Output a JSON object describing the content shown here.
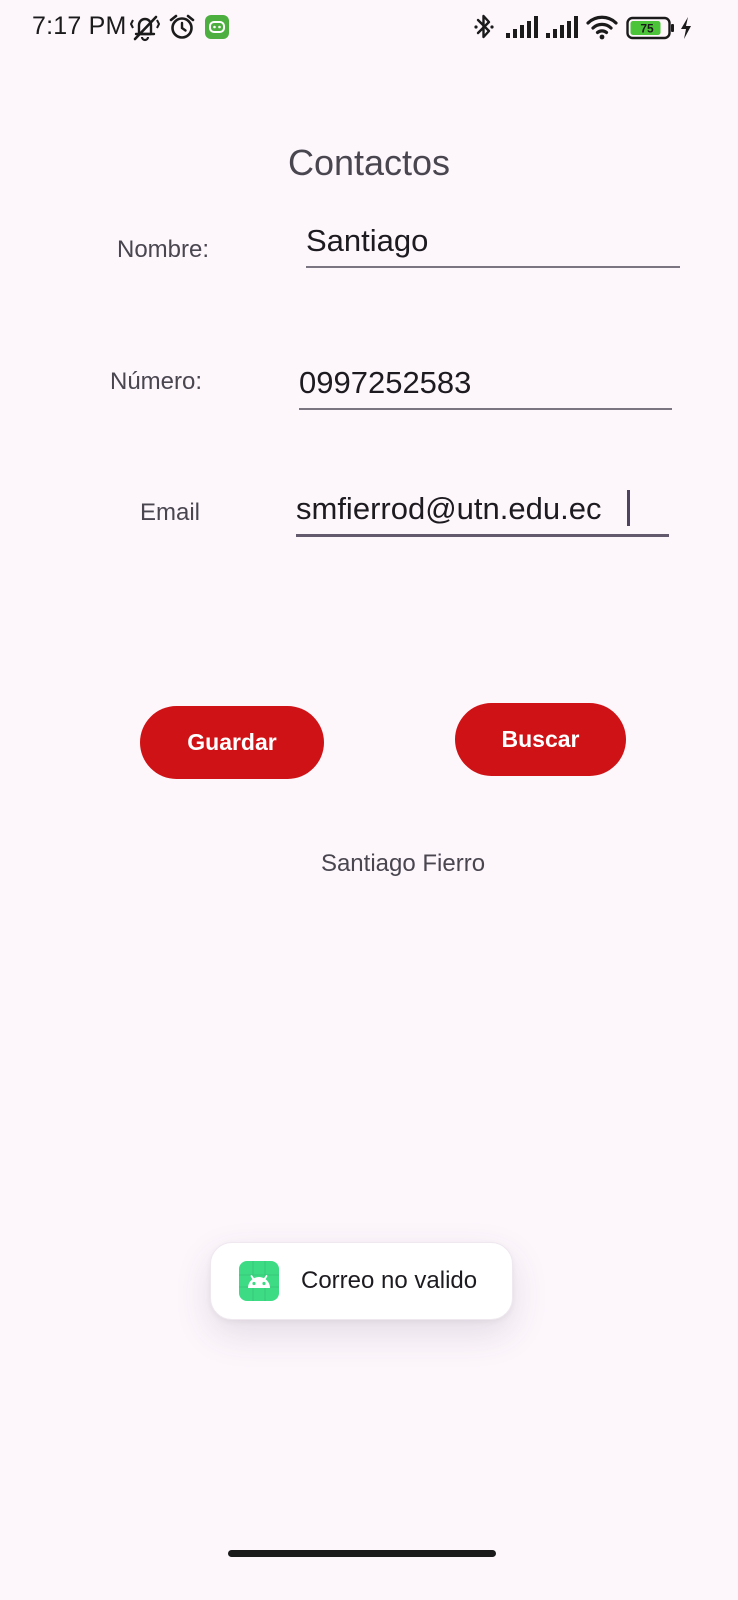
{
  "status_bar": {
    "time": "7:17 PM",
    "battery_level": "75",
    "icons": [
      "vibrate-off-icon",
      "alarm-icon",
      "app-notification-icon",
      "bluetooth-icon",
      "signal-icon",
      "signal-icon",
      "wifi-icon",
      "battery-icon",
      "charging-icon"
    ]
  },
  "page": {
    "title": "Contactos"
  },
  "form": {
    "name_label": "Nombre:",
    "name_value": "Santiago",
    "number_label": "Número:",
    "number_value": "0997252583",
    "email_label": "Email",
    "email_value": "smfierrod@utn.edu.ec"
  },
  "actions": {
    "save_label": "Guardar",
    "search_label": "Buscar"
  },
  "result": {
    "text": "Santiago Fierro"
  },
  "toast": {
    "icon": "android-icon",
    "message": "Correo no valido"
  },
  "colors": {
    "background": "#fdf7fc",
    "button": "#cf1215",
    "battery": "#4cc43a"
  }
}
